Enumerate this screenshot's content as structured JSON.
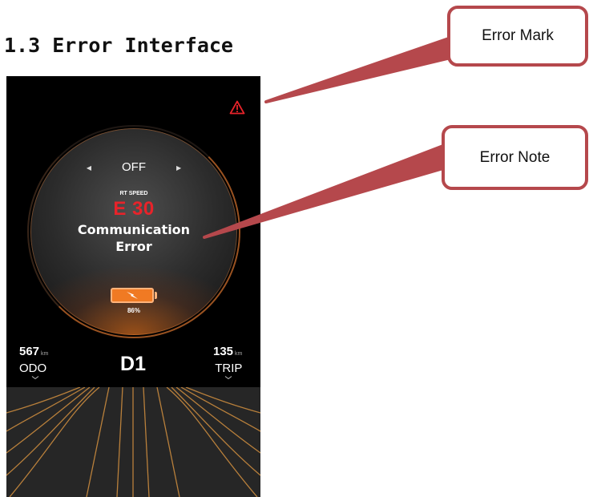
{
  "section": {
    "title": "1.3 Error Interface"
  },
  "display": {
    "mode": {
      "value": "OFF",
      "prev_icon": "chevron-left-icon",
      "next_icon": "chevron-right-icon"
    },
    "speed_label": "RT SPEED",
    "error": {
      "code": "E 30",
      "message_line1": "Communication",
      "message_line2": "Error"
    },
    "battery": {
      "percent": "86%",
      "level": 0.86,
      "icon": "charging-bolt-icon"
    },
    "odo": {
      "value": "567",
      "unit": "km",
      "label": "ODO"
    },
    "gear": "D1",
    "trip": {
      "value": "135",
      "unit": "km",
      "label": "TRIP"
    },
    "warning_icon": "warning-triangle-icon"
  },
  "callouts": [
    {
      "label": "Error Mark"
    },
    {
      "label": "Error Note"
    }
  ],
  "colors": {
    "error_red": "#e8232a",
    "accent_orange": "#f07a23",
    "callout_border": "#b5484c",
    "screen_bg": "#000000"
  }
}
